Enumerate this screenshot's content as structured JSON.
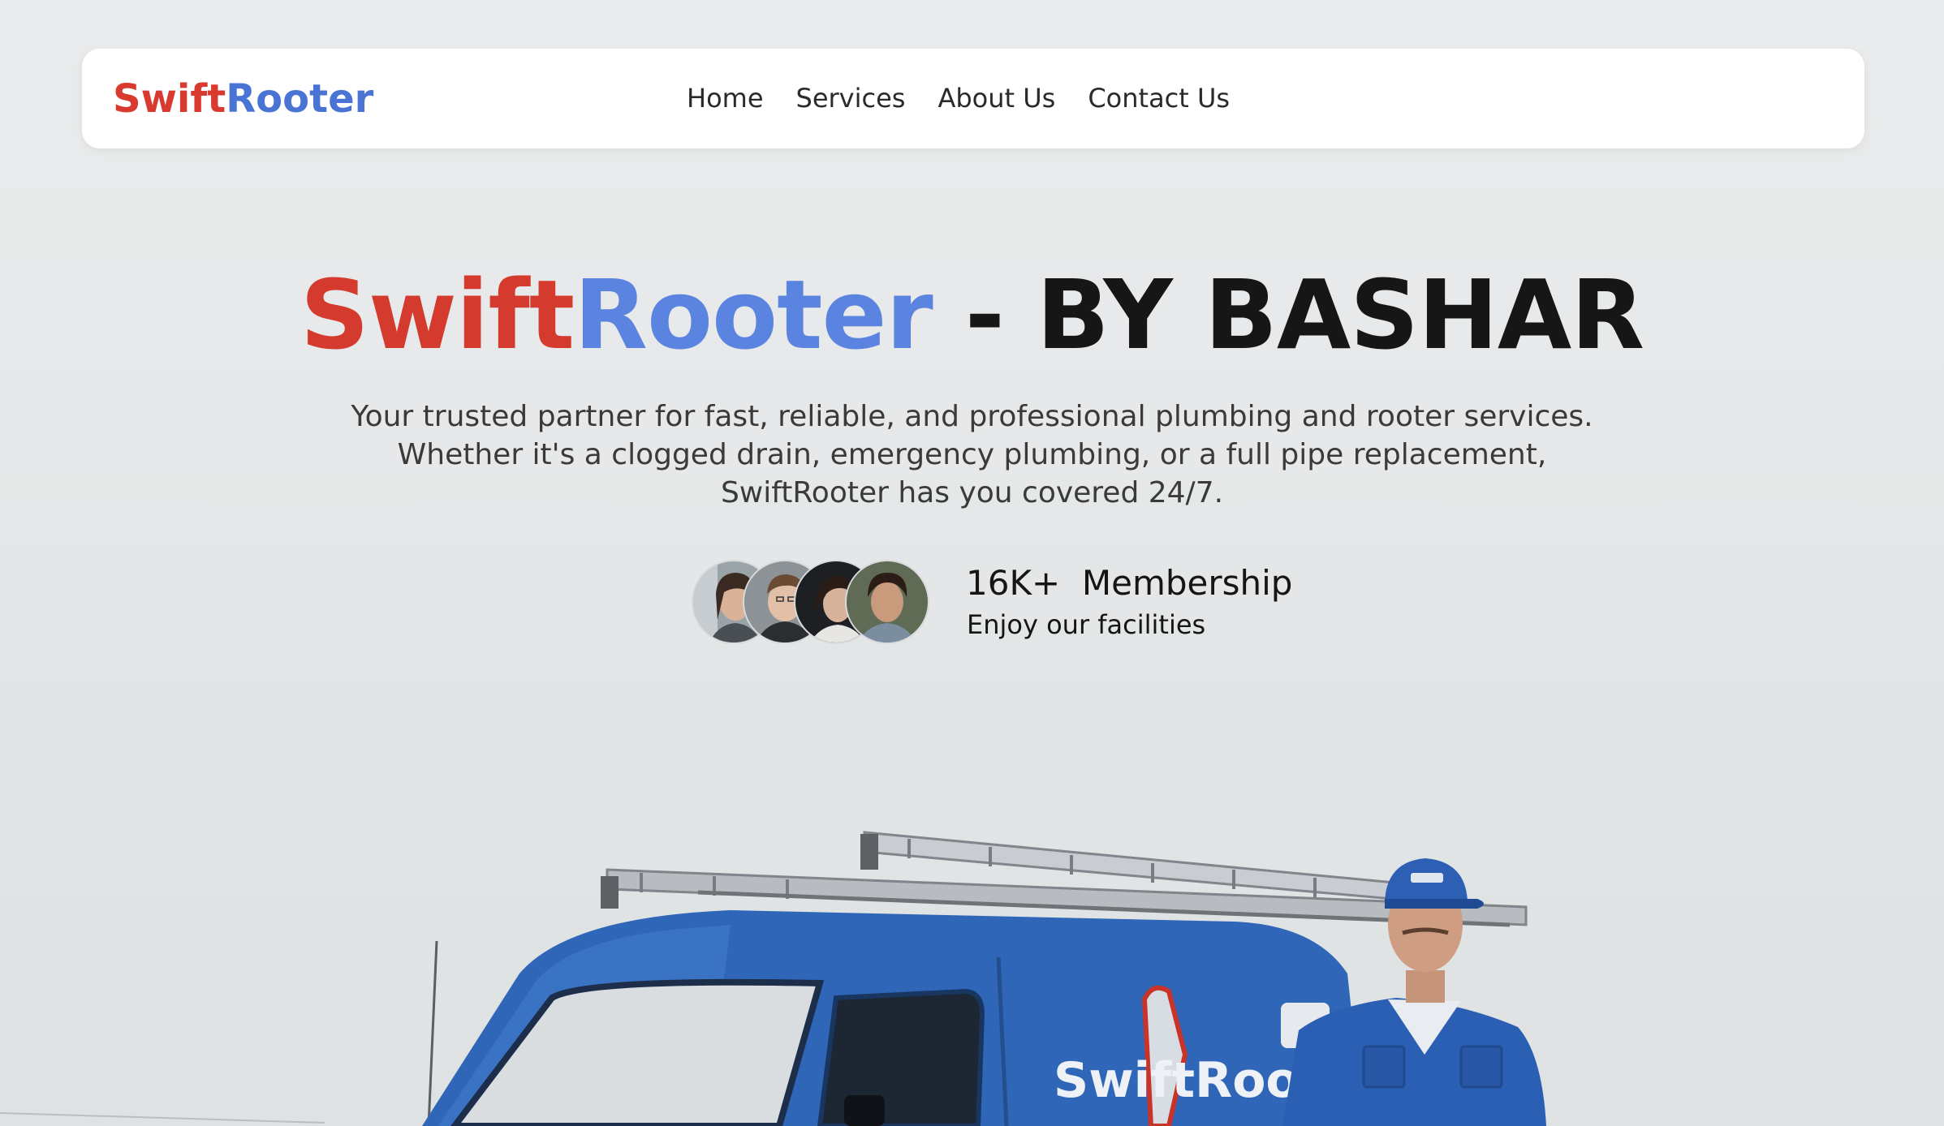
{
  "navbar": {
    "logo_part1": "Swift",
    "logo_part2": "Rooter",
    "links": [
      "Home",
      "Services",
      "About Us",
      "Contact Us"
    ]
  },
  "hero": {
    "title_part1": "Swift",
    "title_part2": "Rooter",
    "title_part3": " - BY BASHAR",
    "description": "Your trusted partner for fast, reliable, and professional plumbing and rooter services. Whether it's a clogged drain, emergency plumbing, or a full pipe replacement, SwiftRooter has you covered 24/7."
  },
  "membership": {
    "count": "16K+  Membership",
    "subtitle": "Enjoy our facilities"
  },
  "photo": {
    "van_brand": "SwiftRooter"
  },
  "colors": {
    "brand_red": "#d93a2f",
    "brand_blue": "#4a74d4",
    "hero_blue": "#5b83e0",
    "van_blue": "#2f66b8"
  }
}
